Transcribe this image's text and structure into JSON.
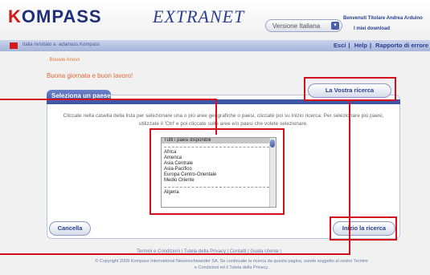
{
  "header": {
    "logo": "KOMPASS",
    "logo_sub": "EXTRANET",
    "language": "Versione Italiana",
    "welcome": "Benvenuti Titolare Andrea Arduino",
    "my_download": "I miei download"
  },
  "nav": {
    "breadcrumb": "Italia rivisitato a ·adamass Kompass",
    "links": [
      "Esci",
      "Help",
      "Rapporto di errore"
    ],
    "separators": [
      "|",
      "|"
    ]
  },
  "intro": {
    "label": "· Bouwie Ariovx",
    "greeting": "Buona giornata e buon lavoro!"
  },
  "panel": {
    "tab_title": "Seleziona un paese",
    "research_button": "La Vostra ricerca",
    "instructions": "Cliccate nella casella della lista per selezionare una o più aree geografiche o paesi, cliccate poi su Inizio ricerca. Per selezionare più paesi, utilizzate il 'Ctrl' e poi cliccate sulle aree e/o paesi che volete selezionare.",
    "list": {
      "selected": "Tutti i paesi disponibili",
      "regions": [
        "Africa",
        "America",
        "Asia Centrale",
        "Asia-Pacifico",
        "Europa Centro-Orientale",
        "Medio Oriente"
      ],
      "countries": [
        "Algeria"
      ]
    },
    "cancel_button": "Cancella",
    "start_button": "Inizio la ricerca"
  },
  "footer": {
    "links": "Termini e Condizioni | Tutela della Privacy | Contatti | Guida Utente |",
    "copyright": "© Copyright 2009  Kompass International Neuenschwander SA. Se continuate la ricerca da questa pagina, sarete soggetto al nostro Termini e Condizioni ed il Tutela della Privacy."
  },
  "colors": {
    "accent": "#3f56a5",
    "brand_red": "#d11b1b",
    "annotation": "#d4101c"
  }
}
